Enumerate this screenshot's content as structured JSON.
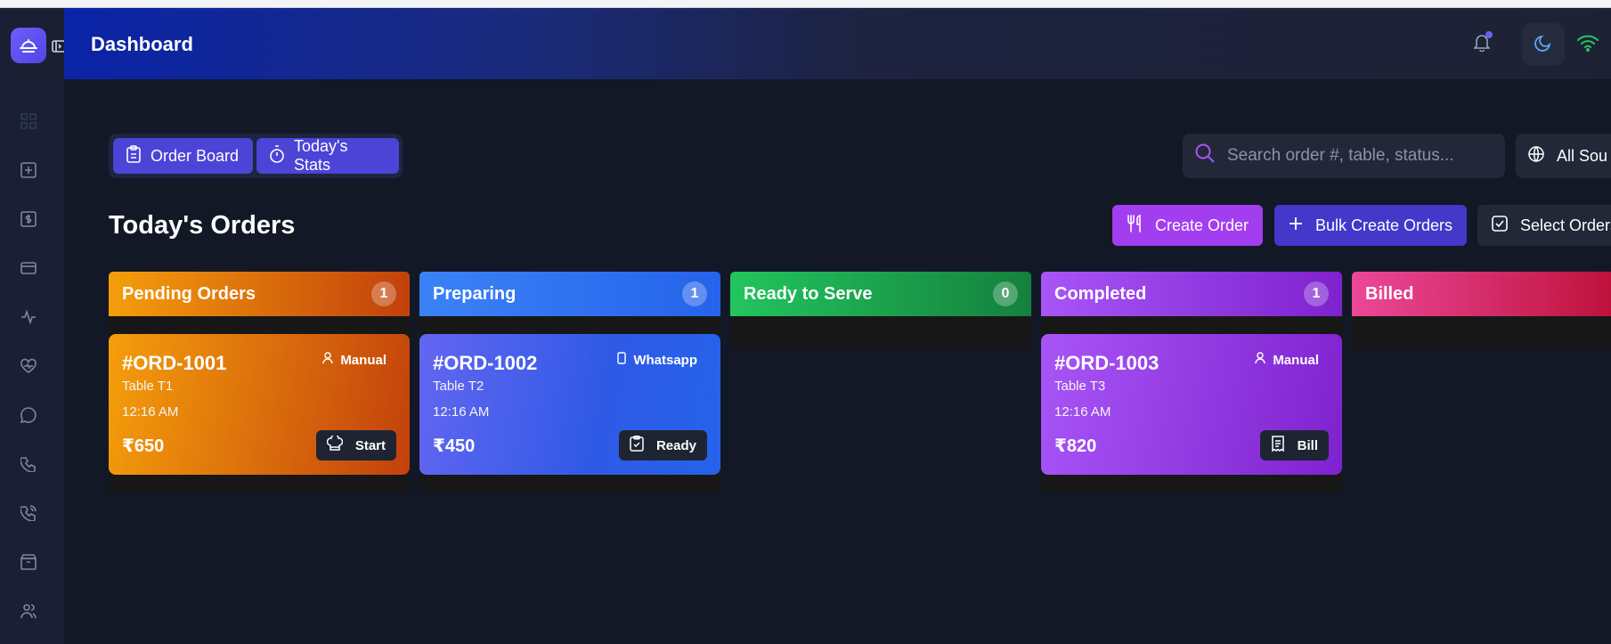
{
  "header": {
    "title": "Dashboard"
  },
  "icons": {
    "logo": "chef-dish-icon",
    "collapse": "sidebar-collapse-icon",
    "nav": [
      "grid-icon",
      "plus-square-icon",
      "dollar-icon",
      "card-icon",
      "activity-icon",
      "heart-pulse-icon",
      "chat-icon",
      "phone-icon",
      "phone-call-icon",
      "package-icon",
      "users-icon"
    ],
    "bell": "bell-icon",
    "theme": "moon-icon",
    "wifi": "wifi-icon"
  },
  "tabs": [
    {
      "label": "Order Board",
      "icon": "clipboard-icon"
    },
    {
      "label": "Today's Stats",
      "icon": "timer-icon"
    }
  ],
  "search": {
    "placeholder": "Search order #, table, status..."
  },
  "source_filter": {
    "label": "All Sou"
  },
  "page": {
    "title": "Today's Orders"
  },
  "actions": {
    "create": "Create Order",
    "bulk": "Bulk Create Orders",
    "select": "Select Orders"
  },
  "columns": [
    {
      "title": "Pending Orders",
      "count": "1",
      "color_from": "#f59e0b",
      "color_to": "#c2410c",
      "cards": [
        {
          "id": "#ORD-1001",
          "source": "Manual",
          "table": "Table T1",
          "time": "12:16 AM",
          "amount": "₹650",
          "action": "Start"
        }
      ]
    },
    {
      "title": "Preparing",
      "count": "1",
      "color_from": "#3b82f6",
      "color_to": "#2563eb",
      "cards": [
        {
          "id": "#ORD-1002",
          "source": "Whatsapp",
          "table": "Table T2",
          "time": "12:16 AM",
          "amount": "₹450",
          "action": "Ready"
        }
      ]
    },
    {
      "title": "Ready to Serve",
      "count": "0",
      "color_from": "#22c55e",
      "color_to": "#15803d",
      "cards": []
    },
    {
      "title": "Completed",
      "count": "1",
      "color_from": "#a855f7",
      "color_to": "#7e22ce",
      "cards": [
        {
          "id": "#ORD-1003",
          "source": "Manual",
          "table": "Table T3",
          "time": "12:16 AM",
          "amount": "₹820",
          "action": "Bill"
        }
      ]
    },
    {
      "title": "Billed",
      "count": "",
      "color_from": "#ec4899",
      "color_to": "#be123c",
      "cards": []
    }
  ]
}
